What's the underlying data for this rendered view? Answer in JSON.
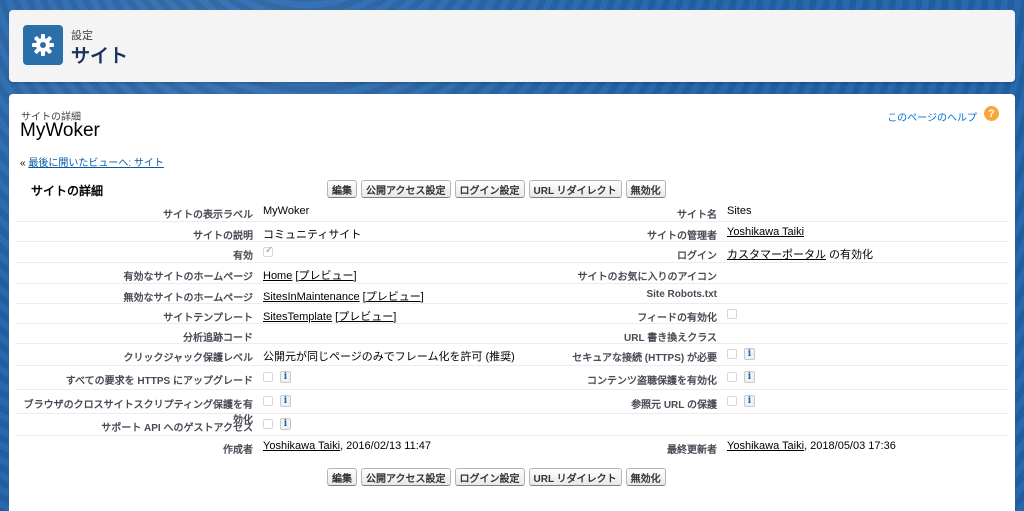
{
  "header": {
    "sub": "設定",
    "title": "サイト",
    "icon": "gear-icon"
  },
  "detail": {
    "sub": "サイトの詳細",
    "title": "MyWoker",
    "help_link": "このページのヘルプ",
    "breadcrumb_prefix": "« ",
    "breadcrumb_link": "最後に開いたビューへ: サイト",
    "section_title": "サイトの詳細"
  },
  "buttons": [
    "編集",
    "公開アクセス設定",
    "ログイン設定",
    "URL リダイレクト",
    "無効化"
  ],
  "fields": {
    "display_label": {
      "label": "サイトの表示ラベル",
      "value": "MyWoker"
    },
    "site_name": {
      "label": "サイト名",
      "value": "Sites"
    },
    "description": {
      "label": "サイトの説明",
      "value": "コミュニティサイト"
    },
    "admin": {
      "label": "サイトの管理者",
      "value": "Yoshikawa Taiki"
    },
    "active": {
      "label": "有効",
      "checked": true
    },
    "login": {
      "label": "ログイン",
      "link": "カスタマーポータル",
      "suffix": " の有効化"
    },
    "active_home": {
      "label": "有効なサイトのホームページ",
      "link": "Home",
      "preview": "プレビュー"
    },
    "favicon": {
      "label": "サイトのお気に入りのアイコン",
      "value": ""
    },
    "inactive_home": {
      "label": "無効なサイトのホームページ",
      "link": "SitesInMaintenance",
      "preview": "プレビュー"
    },
    "robots": {
      "label": "Site Robots.txt",
      "value": ""
    },
    "template": {
      "label": "サイトテンプレート",
      "link": "SitesTemplate",
      "preview": "プレビュー"
    },
    "feeds": {
      "label": "フィードの有効化",
      "checked": false
    },
    "analytics": {
      "label": "分析追跡コード",
      "value": ""
    },
    "url_rewriter": {
      "label": "URL 書き換えクラス",
      "value": ""
    },
    "clickjack": {
      "label": "クリックジャック保護レベル",
      "value": "公開元が同じページのみでフレーム化を許可 (推奨)"
    },
    "https": {
      "label": "セキュアな接続 (HTTPS) が必要",
      "checked": false
    },
    "upgrade_https": {
      "label": "すべての要求を HTTPS にアップグレード",
      "checked": false
    },
    "content_sniff": {
      "label": "コンテンツ盗聴保護を有効化",
      "checked": false
    },
    "xss": {
      "label": "ブラウザのクロスサイトスクリプティング保護を有効化",
      "checked": false
    },
    "referrer": {
      "label": "参照元 URL の保護",
      "checked": false
    },
    "guest_api": {
      "label": "サポート API へのゲストアクセス",
      "checked": false
    },
    "created_by": {
      "label": "作成者",
      "link": "Yoshikawa Taiki",
      "date": ", 2016/02/13 11:47"
    },
    "modified_by": {
      "label": "最終更新者",
      "link": "Yoshikawa Taiki",
      "date": ", 2018/05/03 17:36"
    }
  },
  "colors": {
    "accent": "#2a6fa8",
    "help_icon": "#f8a53a",
    "link": "#0070d2"
  }
}
